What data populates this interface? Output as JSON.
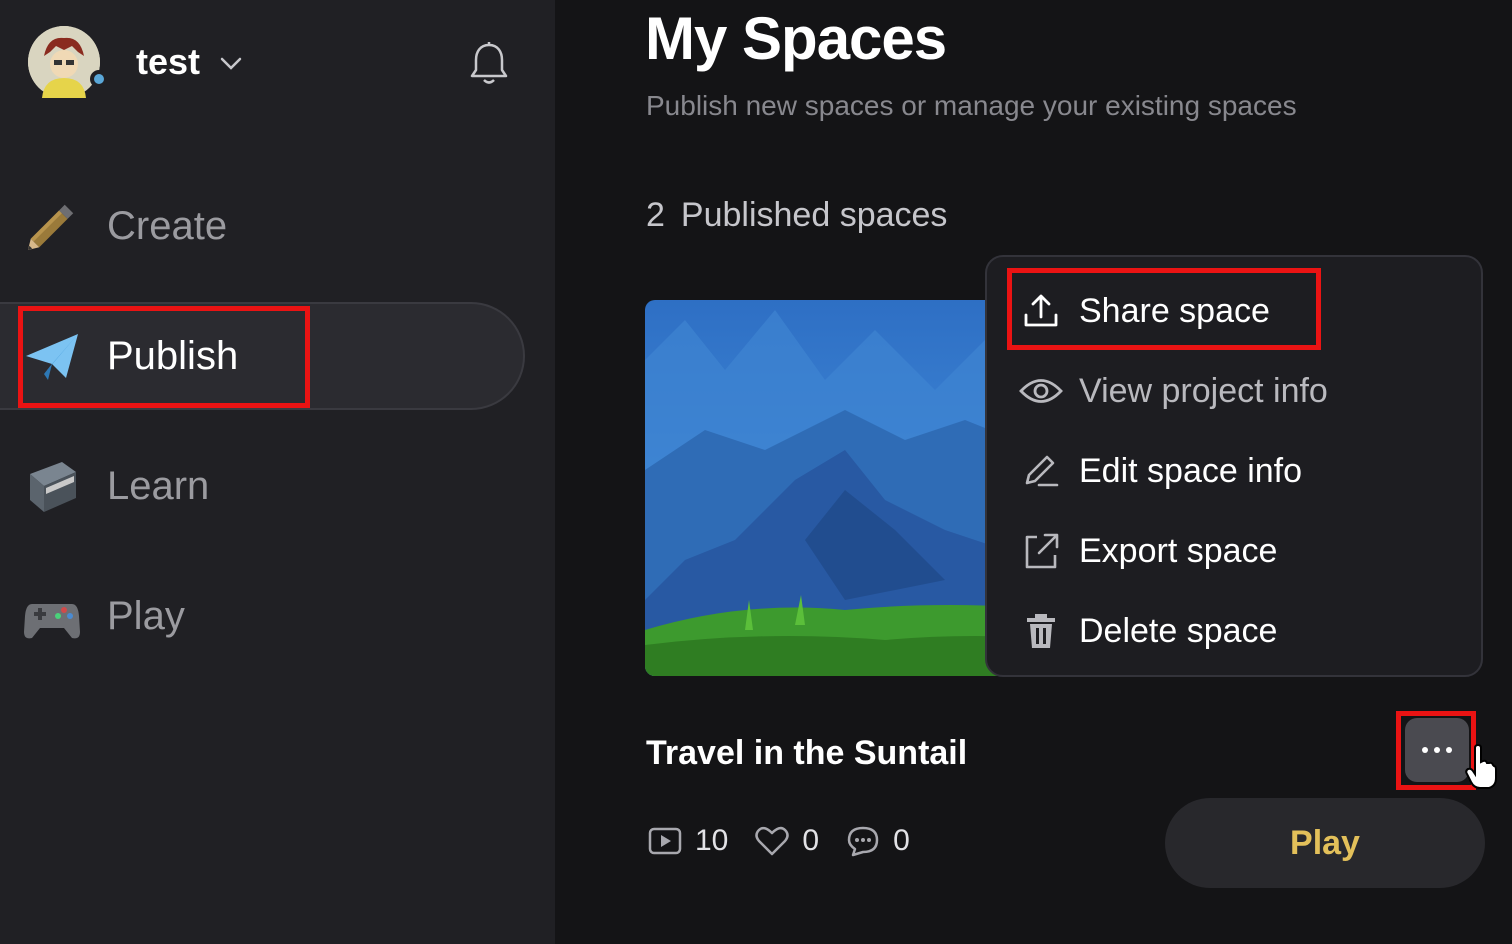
{
  "user": {
    "name": "test"
  },
  "nav": {
    "items": [
      {
        "label": "Create",
        "icon": "pencil-icon"
      },
      {
        "label": "Publish",
        "icon": "paper-plane-icon"
      },
      {
        "label": "Learn",
        "icon": "book-icon"
      },
      {
        "label": "Play",
        "icon": "gamepad-icon"
      }
    ],
    "active": "Publish"
  },
  "main": {
    "title": "My Spaces",
    "subtitle": "Publish new spaces or manage your existing spaces",
    "published_count": "2",
    "published_label": "Published spaces"
  },
  "space": {
    "title": "Travel in the Suntail",
    "views": "10",
    "likes": "0",
    "comments": "0",
    "play_label": "Play"
  },
  "menu": {
    "items": [
      {
        "label": "Share space",
        "icon": "upload-icon"
      },
      {
        "label": "View project info",
        "icon": "eye-icon"
      },
      {
        "label": "Edit space info",
        "icon": "pencil-icon"
      },
      {
        "label": "Export space",
        "icon": "export-icon"
      },
      {
        "label": "Delete space",
        "icon": "trash-icon"
      }
    ]
  },
  "colors": {
    "accent_play": "#e3c05a",
    "highlight": "#ea1313",
    "sidebar_bg": "#202024",
    "main_bg": "#141416"
  }
}
